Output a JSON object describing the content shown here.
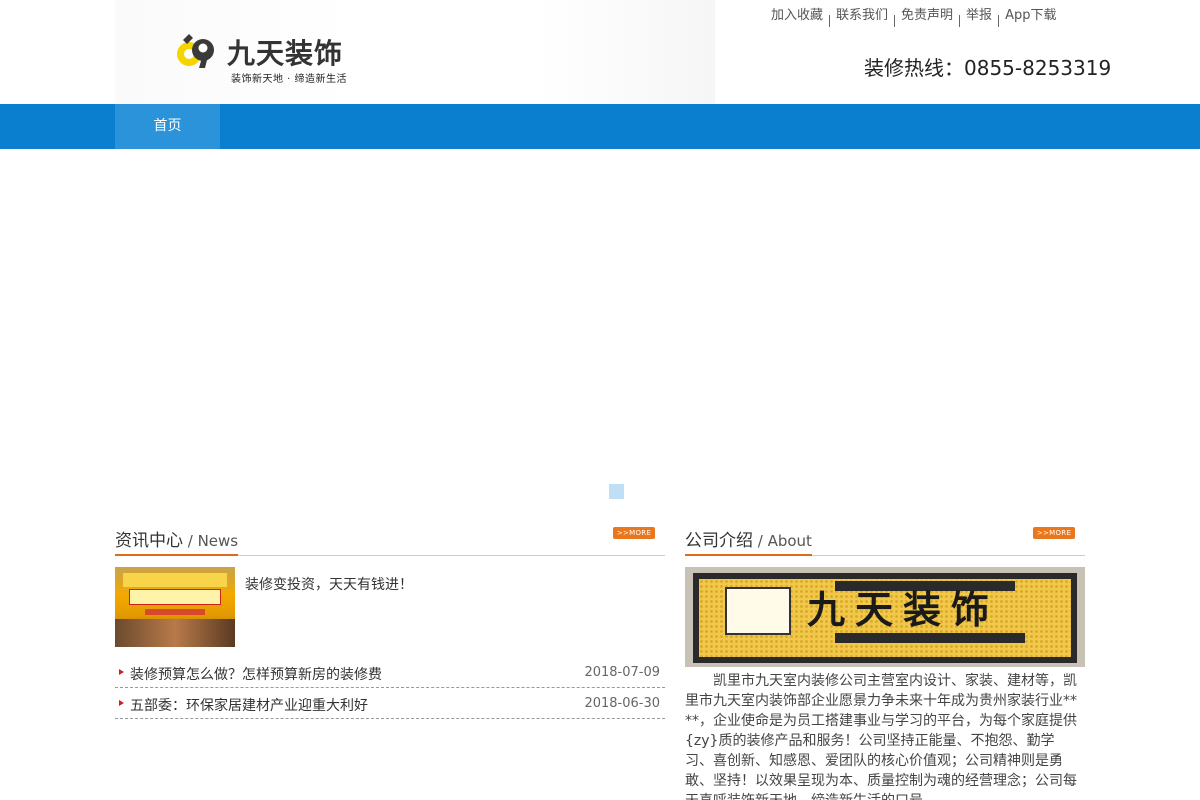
{
  "header": {
    "logo_title": "九天装饰",
    "logo_slogan": "装饰新天地 · 缔造新生活",
    "top_links": [
      "加入收藏",
      "联系我们",
      "免责声明",
      "举报",
      "App下载"
    ],
    "hotline": "装修热线：0855-8253319"
  },
  "nav": {
    "items": [
      "首页"
    ]
  },
  "news": {
    "title_cn": "资讯中心",
    "title_en": " / News",
    "more_label": ">>MORE",
    "featured_title": "装修变投资，天天有钱进！",
    "items": [
      {
        "title": "装修预算怎么做？怎样预算新房的装修费",
        "date": "2018-07-09"
      },
      {
        "title": "五部委：环保家居建材产业迎重大利好",
        "date": "2018-06-30"
      }
    ]
  },
  "about": {
    "title_cn": "公司介绍",
    "title_en": " / About",
    "more_label": ">>MORE",
    "sign_text": "九天装饰",
    "text": "凯里市九天室内装修公司主营室内设计、家装、建材等，凯里市九天室内装饰部企业愿景力争未来十年成为贵州家装行业****，企业使命是为员工搭建事业与学习的平台，为每个家庭提供{zy}质的装修产品和服务！公司坚持正能量、不抱怨、勤学习、喜创新、知感恩、爱团队的核心价值观；公司精神则是勇敢、坚持！以效果呈现为本、质量控制为魂的经营理念；公司每天喜呼装饰新天地，缔造新生活的口号。"
  },
  "colors": {
    "nav_blue": "#0b7fcf",
    "nav_active": "#2a93d9",
    "accent_orange": "#e06a1b",
    "bullet_red": "#d41e1e"
  }
}
